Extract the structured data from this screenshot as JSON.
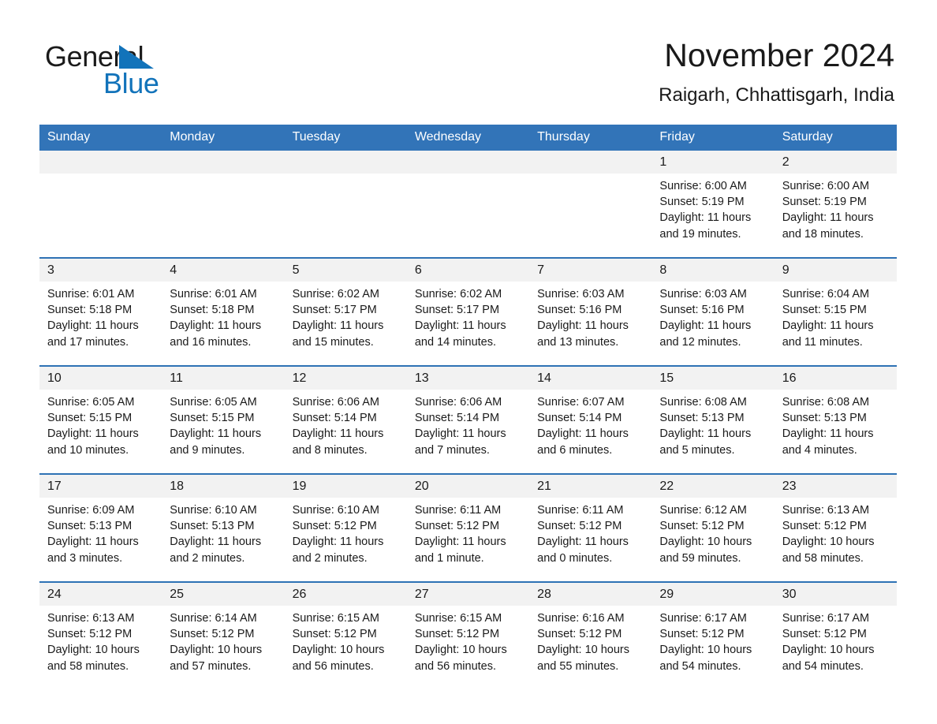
{
  "brand": {
    "name_part1": "General",
    "name_part2": "Blue",
    "triangle_color": "#1273ba"
  },
  "header": {
    "title": "November 2024",
    "location": "Raigarh, Chhattisgarh, India"
  },
  "theme": {
    "header_bg": "#3274b8",
    "header_text": "#ffffff",
    "row_separator": "#2e72b5",
    "daynum_band_bg": "#f2f2f2",
    "page_bg": "#ffffff",
    "text": "#1a1a1a"
  },
  "calendar": {
    "weekday_headers": [
      "Sunday",
      "Monday",
      "Tuesday",
      "Wednesday",
      "Thursday",
      "Friday",
      "Saturday"
    ],
    "weeks": [
      [
        {
          "day": "",
          "empty": true
        },
        {
          "day": "",
          "empty": true
        },
        {
          "day": "",
          "empty": true
        },
        {
          "day": "",
          "empty": true
        },
        {
          "day": "",
          "empty": true
        },
        {
          "day": "1",
          "sunrise": "Sunrise: 6:00 AM",
          "sunset": "Sunset: 5:19 PM",
          "daylight_l1": "Daylight: 11 hours",
          "daylight_l2": "and 19 minutes."
        },
        {
          "day": "2",
          "sunrise": "Sunrise: 6:00 AM",
          "sunset": "Sunset: 5:19 PM",
          "daylight_l1": "Daylight: 11 hours",
          "daylight_l2": "and 18 minutes."
        }
      ],
      [
        {
          "day": "3",
          "sunrise": "Sunrise: 6:01 AM",
          "sunset": "Sunset: 5:18 PM",
          "daylight_l1": "Daylight: 11 hours",
          "daylight_l2": "and 17 minutes."
        },
        {
          "day": "4",
          "sunrise": "Sunrise: 6:01 AM",
          "sunset": "Sunset: 5:18 PM",
          "daylight_l1": "Daylight: 11 hours",
          "daylight_l2": "and 16 minutes."
        },
        {
          "day": "5",
          "sunrise": "Sunrise: 6:02 AM",
          "sunset": "Sunset: 5:17 PM",
          "daylight_l1": "Daylight: 11 hours",
          "daylight_l2": "and 15 minutes."
        },
        {
          "day": "6",
          "sunrise": "Sunrise: 6:02 AM",
          "sunset": "Sunset: 5:17 PM",
          "daylight_l1": "Daylight: 11 hours",
          "daylight_l2": "and 14 minutes."
        },
        {
          "day": "7",
          "sunrise": "Sunrise: 6:03 AM",
          "sunset": "Sunset: 5:16 PM",
          "daylight_l1": "Daylight: 11 hours",
          "daylight_l2": "and 13 minutes."
        },
        {
          "day": "8",
          "sunrise": "Sunrise: 6:03 AM",
          "sunset": "Sunset: 5:16 PM",
          "daylight_l1": "Daylight: 11 hours",
          "daylight_l2": "and 12 minutes."
        },
        {
          "day": "9",
          "sunrise": "Sunrise: 6:04 AM",
          "sunset": "Sunset: 5:15 PM",
          "daylight_l1": "Daylight: 11 hours",
          "daylight_l2": "and 11 minutes."
        }
      ],
      [
        {
          "day": "10",
          "sunrise": "Sunrise: 6:05 AM",
          "sunset": "Sunset: 5:15 PM",
          "daylight_l1": "Daylight: 11 hours",
          "daylight_l2": "and 10 minutes."
        },
        {
          "day": "11",
          "sunrise": "Sunrise: 6:05 AM",
          "sunset": "Sunset: 5:15 PM",
          "daylight_l1": "Daylight: 11 hours",
          "daylight_l2": "and 9 minutes."
        },
        {
          "day": "12",
          "sunrise": "Sunrise: 6:06 AM",
          "sunset": "Sunset: 5:14 PM",
          "daylight_l1": "Daylight: 11 hours",
          "daylight_l2": "and 8 minutes."
        },
        {
          "day": "13",
          "sunrise": "Sunrise: 6:06 AM",
          "sunset": "Sunset: 5:14 PM",
          "daylight_l1": "Daylight: 11 hours",
          "daylight_l2": "and 7 minutes."
        },
        {
          "day": "14",
          "sunrise": "Sunrise: 6:07 AM",
          "sunset": "Sunset: 5:14 PM",
          "daylight_l1": "Daylight: 11 hours",
          "daylight_l2": "and 6 minutes."
        },
        {
          "day": "15",
          "sunrise": "Sunrise: 6:08 AM",
          "sunset": "Sunset: 5:13 PM",
          "daylight_l1": "Daylight: 11 hours",
          "daylight_l2": "and 5 minutes."
        },
        {
          "day": "16",
          "sunrise": "Sunrise: 6:08 AM",
          "sunset": "Sunset: 5:13 PM",
          "daylight_l1": "Daylight: 11 hours",
          "daylight_l2": "and 4 minutes."
        }
      ],
      [
        {
          "day": "17",
          "sunrise": "Sunrise: 6:09 AM",
          "sunset": "Sunset: 5:13 PM",
          "daylight_l1": "Daylight: 11 hours",
          "daylight_l2": "and 3 minutes."
        },
        {
          "day": "18",
          "sunrise": "Sunrise: 6:10 AM",
          "sunset": "Sunset: 5:13 PM",
          "daylight_l1": "Daylight: 11 hours",
          "daylight_l2": "and 2 minutes."
        },
        {
          "day": "19",
          "sunrise": "Sunrise: 6:10 AM",
          "sunset": "Sunset: 5:12 PM",
          "daylight_l1": "Daylight: 11 hours",
          "daylight_l2": "and 2 minutes."
        },
        {
          "day": "20",
          "sunrise": "Sunrise: 6:11 AM",
          "sunset": "Sunset: 5:12 PM",
          "daylight_l1": "Daylight: 11 hours",
          "daylight_l2": "and 1 minute."
        },
        {
          "day": "21",
          "sunrise": "Sunrise: 6:11 AM",
          "sunset": "Sunset: 5:12 PM",
          "daylight_l1": "Daylight: 11 hours",
          "daylight_l2": "and 0 minutes."
        },
        {
          "day": "22",
          "sunrise": "Sunrise: 6:12 AM",
          "sunset": "Sunset: 5:12 PM",
          "daylight_l1": "Daylight: 10 hours",
          "daylight_l2": "and 59 minutes."
        },
        {
          "day": "23",
          "sunrise": "Sunrise: 6:13 AM",
          "sunset": "Sunset: 5:12 PM",
          "daylight_l1": "Daylight: 10 hours",
          "daylight_l2": "and 58 minutes."
        }
      ],
      [
        {
          "day": "24",
          "sunrise": "Sunrise: 6:13 AM",
          "sunset": "Sunset: 5:12 PM",
          "daylight_l1": "Daylight: 10 hours",
          "daylight_l2": "and 58 minutes."
        },
        {
          "day": "25",
          "sunrise": "Sunrise: 6:14 AM",
          "sunset": "Sunset: 5:12 PM",
          "daylight_l1": "Daylight: 10 hours",
          "daylight_l2": "and 57 minutes."
        },
        {
          "day": "26",
          "sunrise": "Sunrise: 6:15 AM",
          "sunset": "Sunset: 5:12 PM",
          "daylight_l1": "Daylight: 10 hours",
          "daylight_l2": "and 56 minutes."
        },
        {
          "day": "27",
          "sunrise": "Sunrise: 6:15 AM",
          "sunset": "Sunset: 5:12 PM",
          "daylight_l1": "Daylight: 10 hours",
          "daylight_l2": "and 56 minutes."
        },
        {
          "day": "28",
          "sunrise": "Sunrise: 6:16 AM",
          "sunset": "Sunset: 5:12 PM",
          "daylight_l1": "Daylight: 10 hours",
          "daylight_l2": "and 55 minutes."
        },
        {
          "day": "29",
          "sunrise": "Sunrise: 6:17 AM",
          "sunset": "Sunset: 5:12 PM",
          "daylight_l1": "Daylight: 10 hours",
          "daylight_l2": "and 54 minutes."
        },
        {
          "day": "30",
          "sunrise": "Sunrise: 6:17 AM",
          "sunset": "Sunset: 5:12 PM",
          "daylight_l1": "Daylight: 10 hours",
          "daylight_l2": "and 54 minutes."
        }
      ]
    ]
  }
}
